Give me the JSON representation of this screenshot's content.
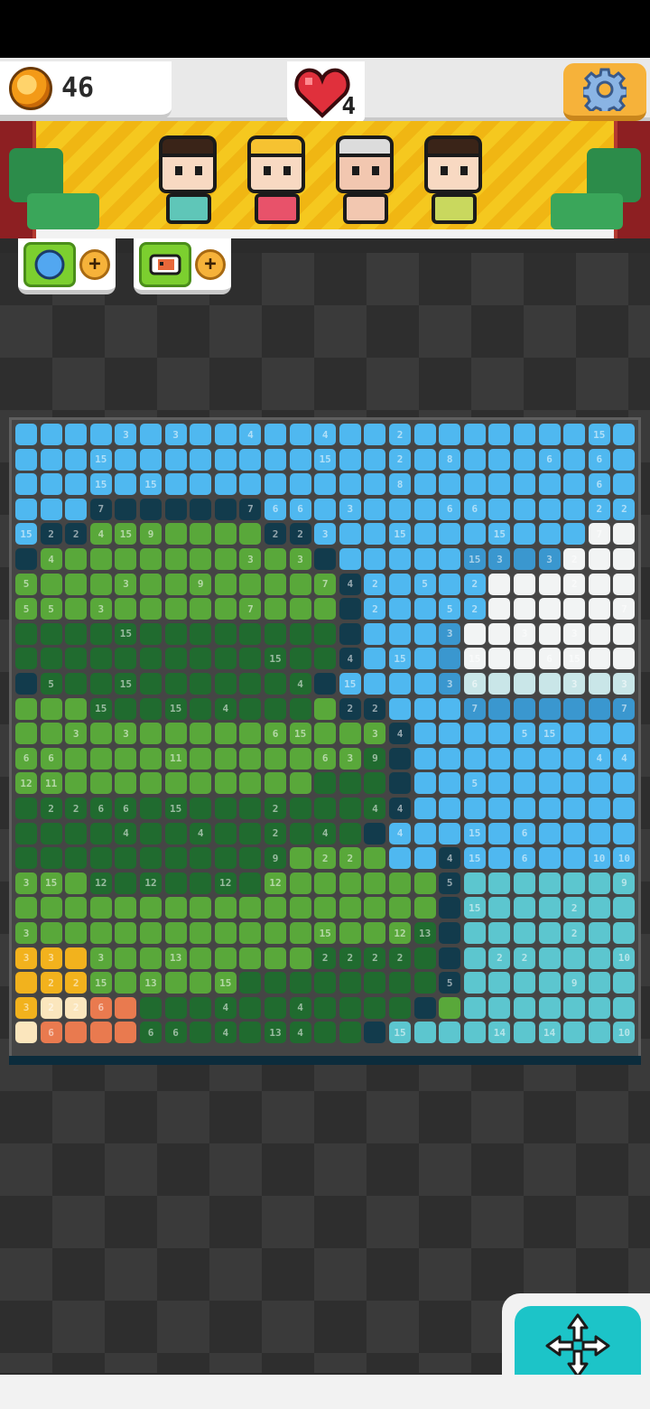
{
  "hud": {
    "coins": "46",
    "lives": "4"
  },
  "powerups": [
    {
      "name": "compass-hint",
      "plus": "+"
    },
    {
      "name": "fox-hint",
      "plus": "+"
    }
  ],
  "colors": {
    "sky": "#4fb8f0",
    "sky_dark": "#3a97cf",
    "grass": "#59a83a",
    "forest": "#206b2f",
    "deep": "#123b4c",
    "teal": "#5cc6cf",
    "cloud": "#f2f4f4",
    "yellow": "#f2b21d",
    "sand": "#fbe6bd",
    "orange": "#e97a4f",
    "accent": "#1cc4c8",
    "settings": "#f6b23a"
  },
  "grid_size": 25,
  "grid_numbers": [
    [
      0,
      4,
      "3"
    ],
    [
      0,
      6,
      "3"
    ],
    [
      0,
      9,
      "4"
    ],
    [
      0,
      12,
      "4"
    ],
    [
      0,
      15,
      "2"
    ],
    [
      0,
      23,
      "15"
    ],
    [
      1,
      3,
      "15"
    ],
    [
      1,
      12,
      "15"
    ],
    [
      1,
      15,
      "2"
    ],
    [
      1,
      17,
      "8"
    ],
    [
      1,
      21,
      "6"
    ],
    [
      1,
      23,
      "6"
    ],
    [
      2,
      3,
      "15"
    ],
    [
      2,
      5,
      "15"
    ],
    [
      2,
      15,
      "8"
    ],
    [
      2,
      23,
      "6"
    ],
    [
      3,
      3,
      "7"
    ],
    [
      3,
      9,
      "7"
    ],
    [
      3,
      10,
      "6"
    ],
    [
      3,
      11,
      "6"
    ],
    [
      3,
      13,
      "3"
    ],
    [
      3,
      17,
      "6"
    ],
    [
      3,
      18,
      "6"
    ],
    [
      3,
      23,
      "2"
    ],
    [
      3,
      24,
      "2"
    ],
    [
      4,
      0,
      "15"
    ],
    [
      4,
      1,
      "2"
    ],
    [
      4,
      2,
      "2"
    ],
    [
      4,
      3,
      "4"
    ],
    [
      4,
      4,
      "15"
    ],
    [
      4,
      5,
      "9"
    ],
    [
      4,
      10,
      "2"
    ],
    [
      4,
      11,
      "2"
    ],
    [
      4,
      12,
      "3"
    ],
    [
      4,
      15,
      "15"
    ],
    [
      4,
      19,
      "15"
    ],
    [
      4,
      23,
      "7"
    ],
    [
      5,
      1,
      "4"
    ],
    [
      5,
      9,
      "3"
    ],
    [
      5,
      11,
      "3"
    ],
    [
      5,
      18,
      "15"
    ],
    [
      5,
      19,
      "3"
    ],
    [
      5,
      21,
      "3"
    ],
    [
      5,
      22,
      "2"
    ],
    [
      6,
      0,
      "5"
    ],
    [
      6,
      4,
      "3"
    ],
    [
      6,
      7,
      "9"
    ],
    [
      6,
      12,
      "7"
    ],
    [
      6,
      13,
      "4"
    ],
    [
      6,
      14,
      "2"
    ],
    [
      6,
      16,
      "5"
    ],
    [
      6,
      18,
      "2"
    ],
    [
      6,
      22,
      "2"
    ],
    [
      7,
      0,
      "5"
    ],
    [
      7,
      1,
      "5"
    ],
    [
      7,
      3,
      "3"
    ],
    [
      7,
      9,
      "7"
    ],
    [
      7,
      14,
      "2"
    ],
    [
      7,
      17,
      "5"
    ],
    [
      7,
      18,
      "2"
    ],
    [
      7,
      24,
      "7"
    ],
    [
      8,
      4,
      "15"
    ],
    [
      8,
      17,
      "3"
    ],
    [
      8,
      20,
      "3"
    ],
    [
      8,
      22,
      "3"
    ],
    [
      9,
      10,
      "15"
    ],
    [
      9,
      13,
      "4"
    ],
    [
      9,
      15,
      "15"
    ],
    [
      9,
      18,
      "15"
    ],
    [
      9,
      21,
      "6"
    ],
    [
      9,
      22,
      "15"
    ],
    [
      10,
      1,
      "5"
    ],
    [
      10,
      4,
      "15"
    ],
    [
      10,
      11,
      "4"
    ],
    [
      10,
      13,
      "15"
    ],
    [
      10,
      17,
      "3"
    ],
    [
      10,
      18,
      "6"
    ],
    [
      10,
      22,
      "3"
    ],
    [
      10,
      24,
      "3"
    ],
    [
      11,
      3,
      "15"
    ],
    [
      11,
      6,
      "15"
    ],
    [
      11,
      8,
      "4"
    ],
    [
      11,
      13,
      "2"
    ],
    [
      11,
      14,
      "2"
    ],
    [
      11,
      18,
      "7"
    ],
    [
      11,
      24,
      "7"
    ],
    [
      12,
      2,
      "3"
    ],
    [
      12,
      4,
      "3"
    ],
    [
      12,
      10,
      "6"
    ],
    [
      12,
      11,
      "15"
    ],
    [
      12,
      14,
      "3"
    ],
    [
      12,
      15,
      "4"
    ],
    [
      12,
      20,
      "5"
    ],
    [
      12,
      21,
      "15"
    ],
    [
      13,
      0,
      "6"
    ],
    [
      13,
      1,
      "6"
    ],
    [
      13,
      6,
      "11"
    ],
    [
      13,
      12,
      "6"
    ],
    [
      13,
      13,
      "3"
    ],
    [
      13,
      14,
      "9"
    ],
    [
      13,
      23,
      "4"
    ],
    [
      13,
      24,
      "4"
    ],
    [
      14,
      0,
      "12"
    ],
    [
      14,
      1,
      "11"
    ],
    [
      14,
      18,
      "5"
    ],
    [
      15,
      1,
      "2"
    ],
    [
      15,
      2,
      "2"
    ],
    [
      15,
      3,
      "6"
    ],
    [
      15,
      4,
      "6"
    ],
    [
      15,
      6,
      "15"
    ],
    [
      15,
      10,
      "2"
    ],
    [
      15,
      14,
      "4"
    ],
    [
      15,
      15,
      "4"
    ],
    [
      16,
      4,
      "4"
    ],
    [
      16,
      7,
      "4"
    ],
    [
      16,
      10,
      "2"
    ],
    [
      16,
      12,
      "4"
    ],
    [
      16,
      15,
      "4"
    ],
    [
      16,
      18,
      "15"
    ],
    [
      16,
      20,
      "6"
    ],
    [
      17,
      10,
      "9"
    ],
    [
      17,
      12,
      "2"
    ],
    [
      17,
      13,
      "2"
    ],
    [
      17,
      17,
      "4"
    ],
    [
      17,
      18,
      "15"
    ],
    [
      17,
      20,
      "6"
    ],
    [
      17,
      23,
      "10"
    ],
    [
      17,
      24,
      "10"
    ],
    [
      18,
      0,
      "3"
    ],
    [
      18,
      1,
      "15"
    ],
    [
      18,
      3,
      "12"
    ],
    [
      18,
      5,
      "12"
    ],
    [
      18,
      8,
      "12"
    ],
    [
      18,
      10,
      "12"
    ],
    [
      18,
      17,
      "5"
    ],
    [
      18,
      24,
      "9"
    ],
    [
      19,
      18,
      "15"
    ],
    [
      19,
      22,
      "2"
    ],
    [
      20,
      0,
      "3"
    ],
    [
      20,
      12,
      "15"
    ],
    [
      20,
      15,
      "12"
    ],
    [
      20,
      16,
      "13"
    ],
    [
      20,
      22,
      "2"
    ],
    [
      21,
      0,
      "3"
    ],
    [
      21,
      1,
      "3"
    ],
    [
      21,
      3,
      "3"
    ],
    [
      21,
      6,
      "13"
    ],
    [
      21,
      12,
      "2"
    ],
    [
      21,
      13,
      "2"
    ],
    [
      21,
      14,
      "2"
    ],
    [
      21,
      15,
      "2"
    ],
    [
      21,
      19,
      "2"
    ],
    [
      21,
      20,
      "2"
    ],
    [
      21,
      24,
      "10"
    ],
    [
      22,
      1,
      "2"
    ],
    [
      22,
      2,
      "2"
    ],
    [
      22,
      3,
      "15"
    ],
    [
      22,
      5,
      "13"
    ],
    [
      22,
      8,
      "15"
    ],
    [
      22,
      17,
      "5"
    ],
    [
      22,
      22,
      "9"
    ],
    [
      23,
      0,
      "3"
    ],
    [
      23,
      1,
      "2"
    ],
    [
      23,
      2,
      "2"
    ],
    [
      23,
      3,
      "6"
    ],
    [
      23,
      8,
      "4"
    ],
    [
      23,
      11,
      "4"
    ],
    [
      24,
      1,
      "6"
    ],
    [
      24,
      5,
      "6"
    ],
    [
      24,
      6,
      "6"
    ],
    [
      24,
      8,
      "4"
    ],
    [
      24,
      10,
      "13"
    ],
    [
      24,
      11,
      "4"
    ],
    [
      24,
      15,
      "15"
    ],
    [
      24,
      19,
      "14"
    ],
    [
      24,
      21,
      "14"
    ],
    [
      24,
      24,
      "10"
    ]
  ]
}
